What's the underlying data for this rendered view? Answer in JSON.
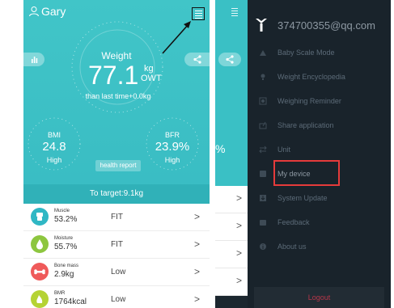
{
  "left": {
    "user_name": "Gary",
    "weight": {
      "label": "Weight",
      "value": "77.1",
      "unit": "kg",
      "tag": "OWT",
      "diff": "than last time+0.0kg"
    },
    "bmi": {
      "label": "BMI",
      "value": "24.8",
      "status": "High"
    },
    "bfr": {
      "label": "BFR",
      "value": "23.9%",
      "status": "High"
    },
    "health_report": "health report",
    "target": "To target:9.1kg",
    "rows": [
      {
        "name": "Muscle",
        "value": "53.2%",
        "status": "FIT",
        "color": "#2fb7c4",
        "icon": "muscle-icon"
      },
      {
        "name": "Moisture",
        "value": "55.7%",
        "status": "FIT",
        "color": "#8dc63f",
        "icon": "water-drop-icon"
      },
      {
        "name": "Bone mass",
        "value": "2.9kg",
        "status": "Low",
        "color": "#ef5a5a",
        "icon": "bone-icon"
      },
      {
        "name": "BMR",
        "value": "1764kcal",
        "status": "Low",
        "color": "#b5d334",
        "icon": "flame-icon"
      }
    ],
    "chevron": ">"
  },
  "right": {
    "email": "374700355@qq.com",
    "behind_pct": "%",
    "menu": [
      {
        "label": "Baby Scale Mode",
        "icon": "baby-icon"
      },
      {
        "label": "Weight Encyclopedia",
        "icon": "lightbulb-icon"
      },
      {
        "label": "Weighing Reminder",
        "icon": "alarm-icon"
      },
      {
        "label": "Share application",
        "icon": "share-icon"
      },
      {
        "label": "Unit",
        "icon": "swap-icon"
      },
      {
        "label": "My device",
        "icon": "device-icon"
      },
      {
        "label": "System Update",
        "icon": "download-icon"
      },
      {
        "label": "Feedback",
        "icon": "feedback-icon"
      },
      {
        "label": "About us",
        "icon": "info-icon"
      }
    ],
    "logout": "Logout",
    "colors": {
      "accent": "#3ac0c5",
      "drawer": "#19232b",
      "highlight": "#e53b3b",
      "logout": "#b7364a"
    }
  }
}
